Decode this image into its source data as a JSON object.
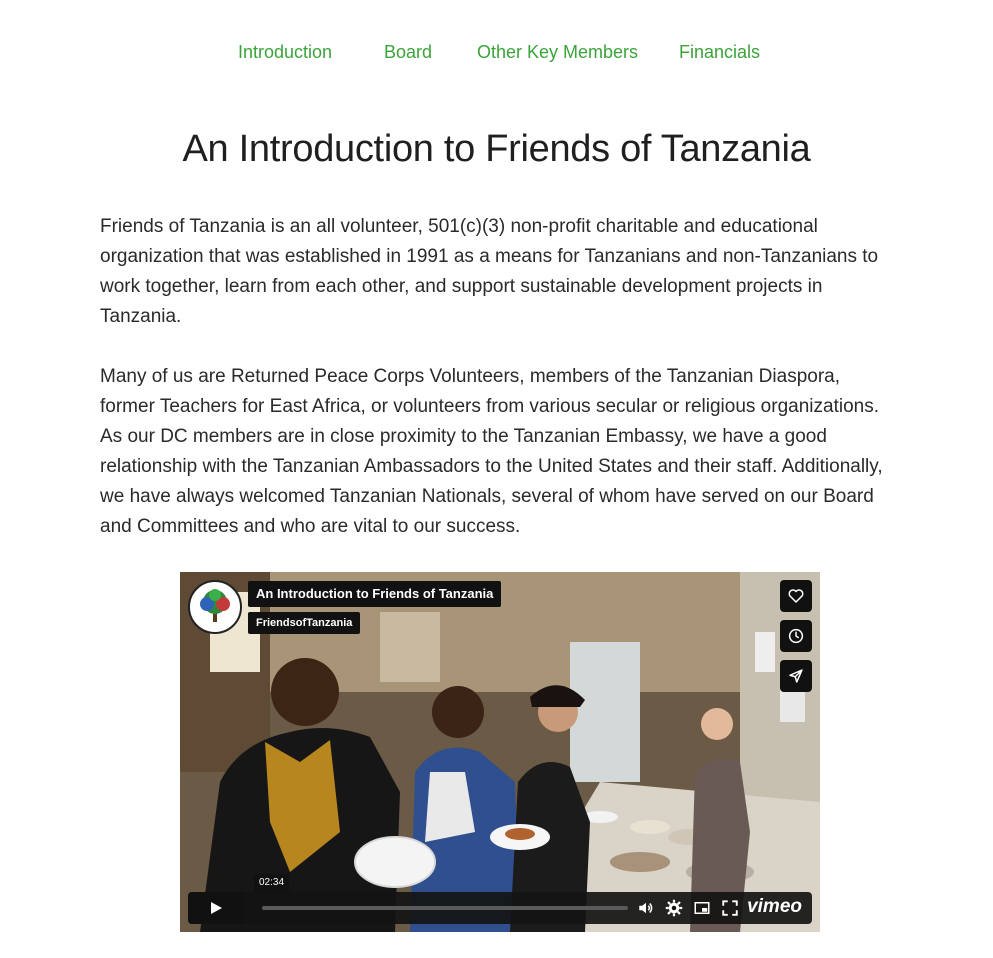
{
  "nav": {
    "items": [
      {
        "label": "Introduction"
      },
      {
        "label": "Board"
      },
      {
        "label": "Other Key Members"
      },
      {
        "label": "Financials"
      }
    ]
  },
  "page": {
    "title": "An Introduction to Friends of Tanzania",
    "paragraphs": [
      "Friends of Tanzania is an all volunteer, 501(c)(3) non-profit charitable and educational organization that was established in 1991 as a means for Tanzanians and non-Tanzanians to work together, learn from each other, and support sustainable development projects in Tanzania.",
      "Many of us are Returned Peace Corps Volunteers, members of the Tanzanian Diaspora, former Teachers for East Africa, or volunteers from various secular or religious organizations. As our DC members are in close proximity to the Tanzanian Embassy, we have a good relationship with the Tanzanian Ambassadors to the United States and their staff. Additionally, we have always welcomed Tanzanian Nationals, several of whom have served on our Board and Committees and who are vital to our success."
    ]
  },
  "video": {
    "title": "An Introduction to Friends of Tanzania",
    "author": "FriendsofTanzania",
    "time": "02:34",
    "brand": "vimeo",
    "progress": 0,
    "icons": [
      "heart-icon",
      "clock-icon",
      "send-icon",
      "play-icon",
      "volume-icon",
      "settings-icon",
      "pip-icon",
      "fullscreen-icon"
    ]
  },
  "colors": {
    "nav_link": "#3aa33a",
    "video_chrome": "#111111"
  }
}
